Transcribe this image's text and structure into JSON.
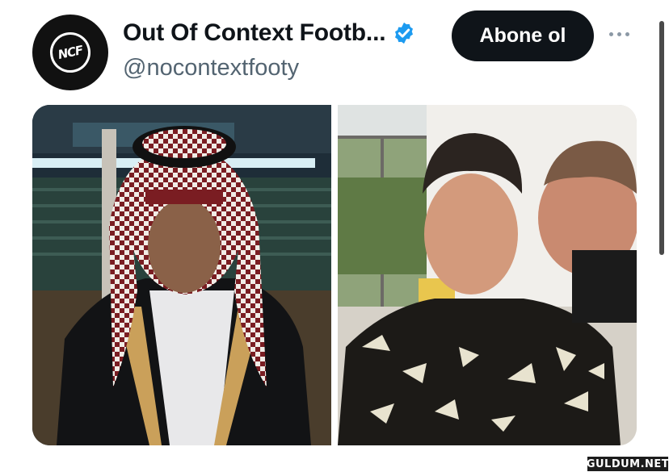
{
  "account": {
    "display_name": "Out Of Context Footb...",
    "handle": "@nocontextfooty",
    "avatar_text": "NCF",
    "verified": true
  },
  "actions": {
    "subscribe_label": "Abone ol",
    "more_icon": "more-horizontal-icon"
  },
  "media": {
    "images": [
      {
        "name": "player-in-saudi-headdress-photo"
      },
      {
        "name": "player-being-kissed-on-cheek-photo"
      }
    ]
  },
  "watermark": "GULDUM.NET",
  "colors": {
    "button_bg": "#0f1419",
    "verified_blue": "#1d9bf0",
    "handle_gray": "#536471"
  }
}
